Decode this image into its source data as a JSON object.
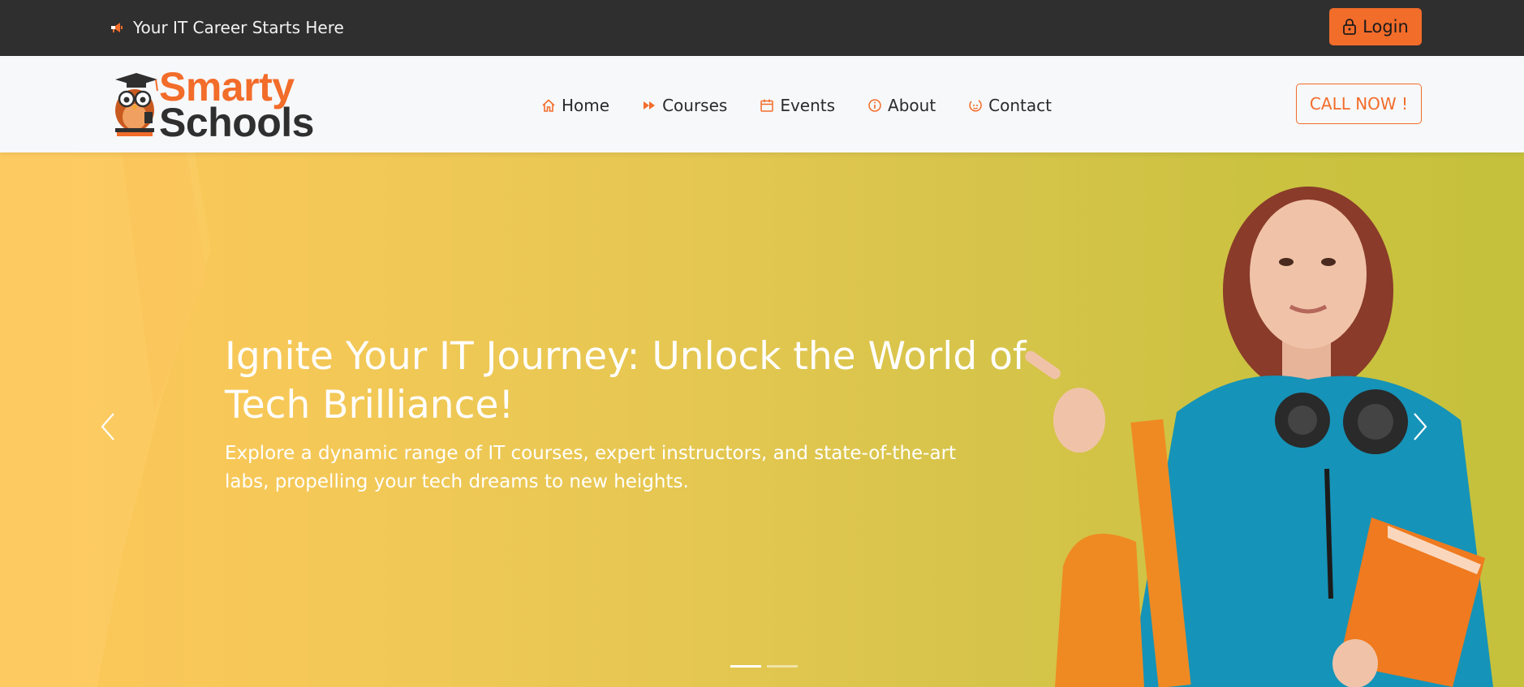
{
  "topbar": {
    "tagline": "Your IT Career Starts Here",
    "login_label": "Login"
  },
  "brand": {
    "line1": "Smarty",
    "line2": "Schools",
    "accent_color": "#f26c2a",
    "dark_color": "#2f2f2f"
  },
  "nav": {
    "items": [
      {
        "label": "Home",
        "icon": "home-icon"
      },
      {
        "label": "Courses",
        "icon": "fast-forward-icon"
      },
      {
        "label": "Events",
        "icon": "calendar-icon"
      },
      {
        "label": "About",
        "icon": "info-icon"
      },
      {
        "label": "Contact",
        "icon": "contact-icon"
      }
    ],
    "call_label": "CALL NOW !"
  },
  "hero": {
    "title": "Ignite Your IT Journey: Unlock the World of Tech Brilliance!",
    "description": "Explore a dynamic range of IT courses, expert instructors, and state-of-the-art labs, propelling your tech dreams to new heights.",
    "slide_count": 2,
    "active_slide": 1
  }
}
